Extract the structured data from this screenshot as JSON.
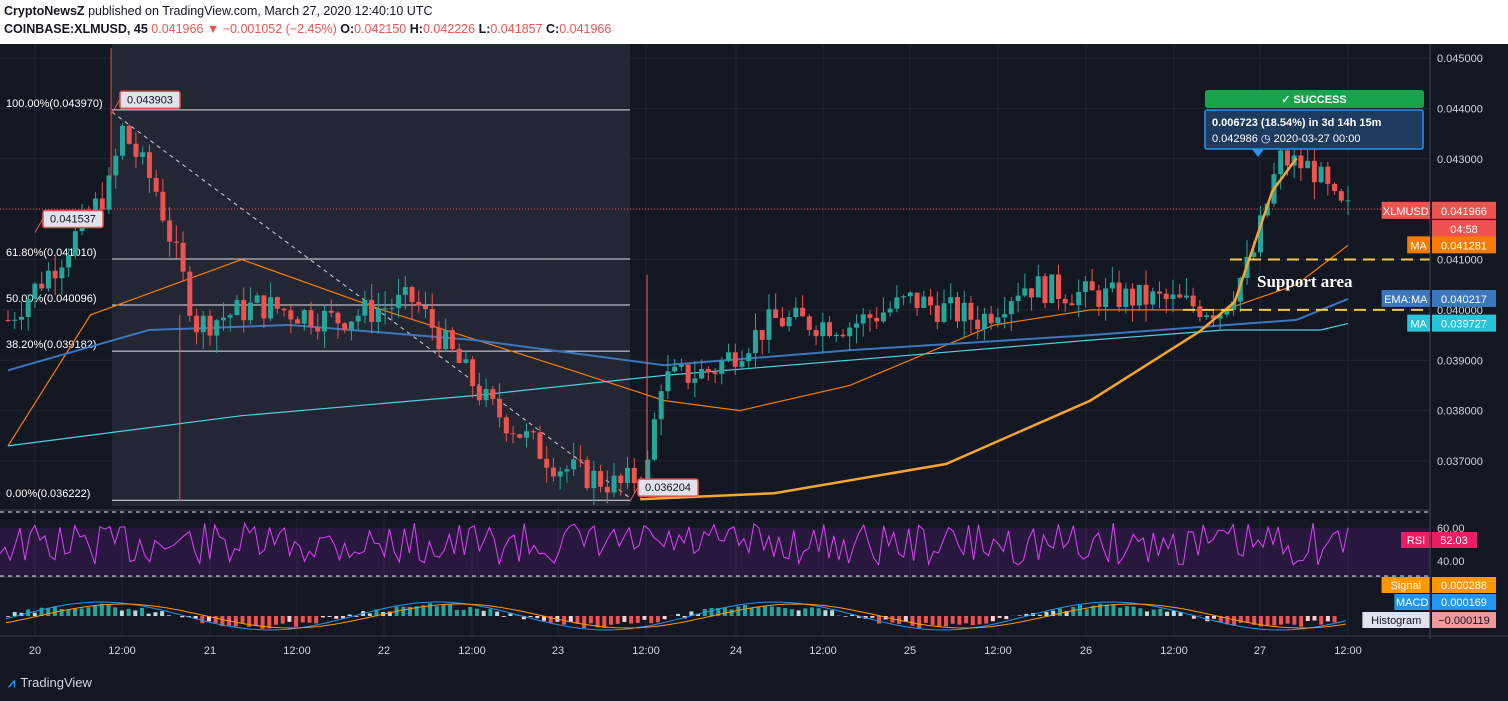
{
  "header": {
    "publisher": "CryptoNewsZ",
    "published_text": "published on TradingView.com, March 27, 2020 12:40:10 UTC",
    "symbol": "COINBASE:XLMUSD, 45",
    "last": "0.041966",
    "change": "−0.001052 (−2.45%)",
    "o_label": "O:",
    "o": "0.042150",
    "h_label": "H:",
    "h": "0.042226",
    "l_label": "L:",
    "l": "0.041857",
    "c_label": "C:",
    "c": "0.041966"
  },
  "footer": {
    "logo": "TradingView"
  },
  "colors": {
    "background": "#131722",
    "up": "#26a69a",
    "down": "#ef5350",
    "ma_orange": "#f57c00",
    "ema_blue": "#3b77c0",
    "ma_cyan": "#4dd0e1",
    "rsi": "#e040fb",
    "macd": "#2196f3",
    "signal": "#ff9800",
    "success": "#16a34a"
  },
  "chart_data": {
    "type": "candlestick",
    "x_tick_labels": [
      "20",
      "12:00",
      "21",
      "12:00",
      "22",
      "12:00",
      "23",
      "12:00",
      "24",
      "12:00",
      "25",
      "12:00",
      "26",
      "12:00",
      "27",
      "12:00"
    ],
    "y_tick_labels": [
      "0.045000",
      "0.044000",
      "0.043000",
      "0.041000",
      "0.040000",
      "0.039000",
      "0.038000",
      "0.037000"
    ],
    "ylim": [
      0.0361,
      0.0452
    ],
    "fib_levels": [
      {
        "label": "100.00%(0.043970)",
        "value": 0.04397
      },
      {
        "label": "61.80%(0.041010)",
        "value": 0.04101
      },
      {
        "label": "50.00%(0.040096)",
        "value": 0.040096
      },
      {
        "label": "38.20%(0.039182)",
        "value": 0.039182
      },
      {
        "label": "0.00%(0.036222)",
        "value": 0.036222
      }
    ],
    "price_labels": [
      {
        "text": "0.043903",
        "value": 0.043903
      },
      {
        "text": "0.041537",
        "value": 0.041537
      },
      {
        "text": "0.036204",
        "value": 0.036204
      }
    ],
    "key_prices": [
      {
        "x": 0.0,
        "y": 0.0398
      },
      {
        "x": 1.5,
        "y": 0.041
      },
      {
        "x": 3.0,
        "y": 0.0425
      },
      {
        "x": 3.3,
        "y": 0.0436
      },
      {
        "x": 4.3,
        "y": 0.0424
      },
      {
        "x": 5.5,
        "y": 0.0397
      },
      {
        "x": 7.3,
        "y": 0.0401
      },
      {
        "x": 9.5,
        "y": 0.0398
      },
      {
        "x": 11.8,
        "y": 0.0402
      },
      {
        "x": 14.0,
        "y": 0.0381
      },
      {
        "x": 16.0,
        "y": 0.0369
      },
      {
        "x": 17.8,
        "y": 0.0365
      },
      {
        "x": 18.6,
        "y": 0.0368
      },
      {
        "x": 19.0,
        "y": 0.0386
      },
      {
        "x": 20.5,
        "y": 0.0388
      },
      {
        "x": 22.3,
        "y": 0.0398
      },
      {
        "x": 24.5,
        "y": 0.0397
      },
      {
        "x": 26.3,
        "y": 0.0402
      },
      {
        "x": 28.3,
        "y": 0.0398
      },
      {
        "x": 29.5,
        "y": 0.0405
      },
      {
        "x": 31.3,
        "y": 0.0403
      },
      {
        "x": 33.5,
        "y": 0.0402
      },
      {
        "x": 35.3,
        "y": 0.04
      },
      {
        "x": 36.2,
        "y": 0.041
      },
      {
        "x": 37.0,
        "y": 0.043
      },
      {
        "x": 38.0,
        "y": 0.0428
      },
      {
        "x": 38.7,
        "y": 0.042
      },
      {
        "x": 39.0,
        "y": 0.041966
      }
    ],
    "series_lines": [
      {
        "name": "MA",
        "color": "#f57c00",
        "points": [
          [
            0,
            0.0373
          ],
          [
            2.4,
            0.0399
          ],
          [
            6.8,
            0.041
          ],
          [
            10.9,
            0.04
          ],
          [
            16.4,
            0.0388
          ],
          [
            19.1,
            0.0382
          ],
          [
            21.3,
            0.038
          ],
          [
            24.5,
            0.0385
          ],
          [
            28.7,
            0.0397
          ],
          [
            31.5,
            0.04
          ],
          [
            35.4,
            0.04
          ],
          [
            37.5,
            0.0405
          ],
          [
            39.0,
            0.041281
          ]
        ]
      },
      {
        "name": "EMA:MA",
        "color": "#3b77c0",
        "points": [
          [
            0,
            0.0388
          ],
          [
            4.1,
            0.0396
          ],
          [
            8.2,
            0.0397
          ],
          [
            13.6,
            0.0394
          ],
          [
            19.1,
            0.0389
          ],
          [
            24.5,
            0.0392
          ],
          [
            31.5,
            0.0395
          ],
          [
            37.5,
            0.0398
          ],
          [
            39.0,
            0.040217
          ]
        ]
      },
      {
        "name": "MA",
        "color": "#4dd0e1",
        "points": [
          [
            0,
            0.0373
          ],
          [
            6.8,
            0.0379
          ],
          [
            13.6,
            0.0383
          ],
          [
            19.1,
            0.0387
          ],
          [
            24.5,
            0.039
          ],
          [
            31.5,
            0.0394
          ],
          [
            35.4,
            0.0396
          ],
          [
            38.2,
            0.0396
          ],
          [
            39.0,
            0.039727
          ]
        ]
      }
    ],
    "curve_points": [
      [
        18.4,
        0.03624
      ],
      [
        22.3,
        0.03636
      ],
      [
        27.3,
        0.03694
      ],
      [
        31.5,
        0.0382
      ],
      [
        34.7,
        0.03958
      ],
      [
        35.7,
        0.04016
      ],
      [
        36.8,
        0.04236
      ],
      [
        37.5,
        0.04301
      ]
    ],
    "support_area": {
      "label": "Support area",
      "upper": 0.041,
      "lower": 0.04
    },
    "success_box": {
      "badge": "✓ SUCCESS",
      "line1": "0.006723 (18.54%) in 3d 14h 15m",
      "line2": "0.042986 ◷ 2020-03-27  00:00"
    },
    "right_labels": [
      {
        "text": "XLMUSD",
        "value": "0.041966",
        "color": "#ef5350"
      },
      {
        "text": "",
        "value": "04:58",
        "color": "#ef5350"
      },
      {
        "text": "MA",
        "value": "0.041281",
        "color": "#f57c00"
      },
      {
        "text": "EMA:MA",
        "value": "0.040217",
        "color": "#3b77c0"
      },
      {
        "text": "MA",
        "value": "0.039727",
        "color": "#26c6da"
      }
    ],
    "rsi": {
      "label": "RSI",
      "value": "52.03",
      "ticks": [
        "60.00",
        "40.00"
      ]
    },
    "macd": {
      "labels": [
        {
          "text": "Signal",
          "value": "0.000288",
          "color": "#ff9800"
        },
        {
          "text": "MACD",
          "value": "0.000169",
          "color": "#2196f3"
        },
        {
          "text": "Histogram",
          "value": "−0.000119",
          "color": "#ef9a9a"
        }
      ]
    }
  }
}
